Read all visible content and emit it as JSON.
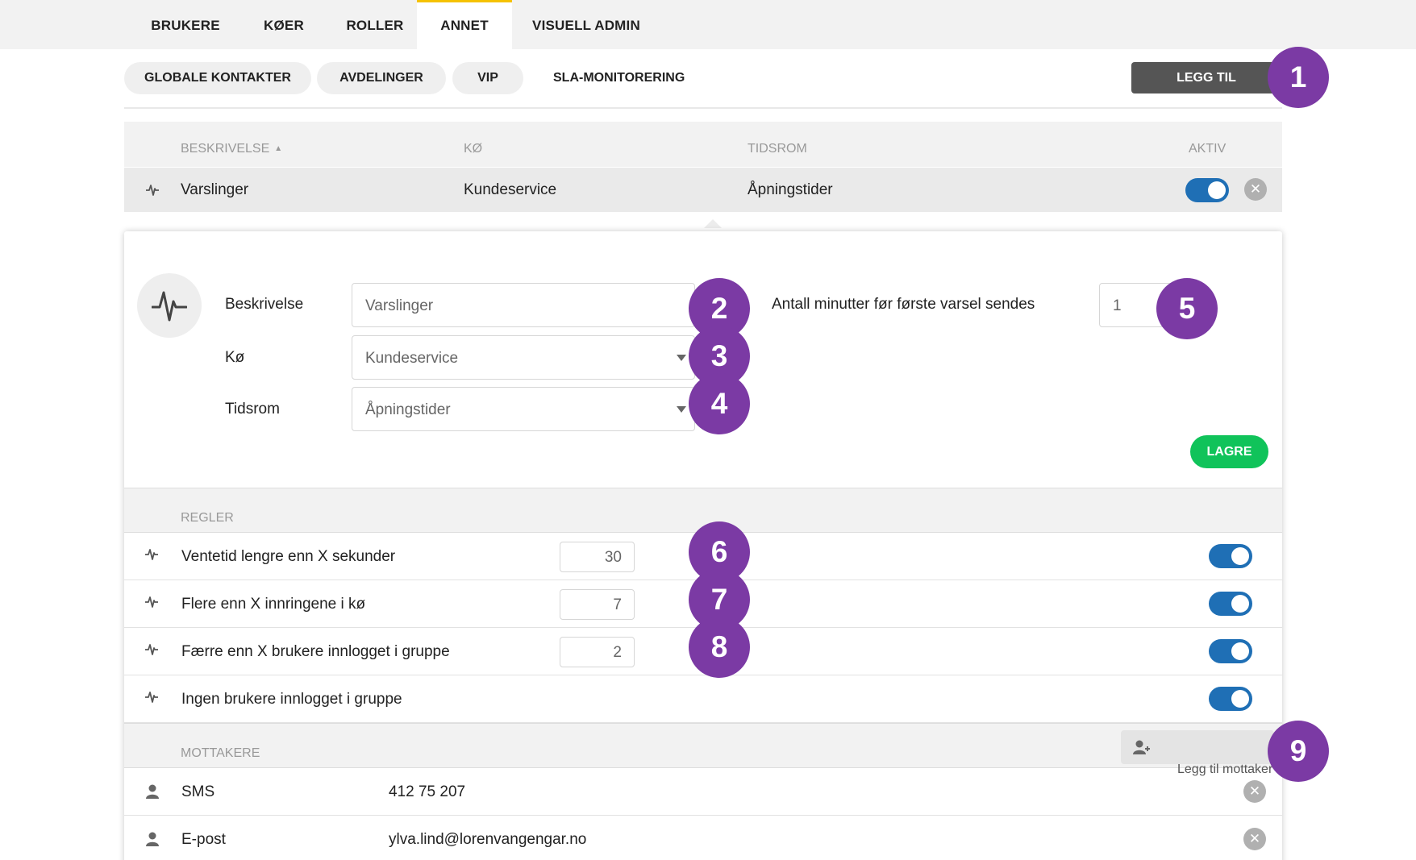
{
  "top_tabs": [
    "BRUKERE",
    "KØER",
    "ROLLER",
    "ANNET",
    "VISUELL ADMIN"
  ],
  "sub_tabs": [
    "GLOBALE KONTAKTER",
    "AVDELINGER",
    "VIP",
    "SLA-MONITORERING"
  ],
  "add_button": "LEGG TIL",
  "table": {
    "columns": [
      "BESKRIVELSE",
      "KØ",
      "TIDSROM",
      "AKTIV"
    ],
    "sort_indicator": "▲",
    "row": {
      "description": "Varslinger",
      "queue": "Kundeservice",
      "period": "Åpningstider",
      "active": true
    }
  },
  "form": {
    "description_label": "Beskrivelse",
    "description_value": "Varslinger",
    "queue_label": "Kø",
    "queue_value": "Kundeservice",
    "period_label": "Tidsrom",
    "period_value": "Åpningstider",
    "minutes_label": "Antall minutter før første varsel sendes",
    "minutes_value": "1",
    "save_label": "LAGRE"
  },
  "rules": {
    "header": "REGLER",
    "items": [
      {
        "label": "Ventetid lengre enn X sekunder",
        "value": "30",
        "active": true
      },
      {
        "label": "Flere enn X innringene i kø",
        "value": "7",
        "active": true
      },
      {
        "label": "Færre enn X brukere innlogget i gruppe",
        "value": "2",
        "active": true
      },
      {
        "label": "Ingen brukere innlogget i gruppe",
        "active": true
      }
    ]
  },
  "recipients": {
    "header": "MOTTAKERE",
    "add_label": "Legg til mottaker",
    "items": [
      {
        "type": "SMS",
        "value": "412 75 207"
      },
      {
        "type": "E-post",
        "value": "ylva.lind@lorenvangengar.no"
      }
    ]
  },
  "callouts": [
    "1",
    "2",
    "3",
    "4",
    "5",
    "6",
    "7",
    "8",
    "9"
  ],
  "colors": {
    "accent_tab": "#f5c200",
    "toggle_on": "#1f6fb5",
    "save": "#10c35a",
    "callout": "#7b3aa4",
    "add_button": "#555555"
  }
}
